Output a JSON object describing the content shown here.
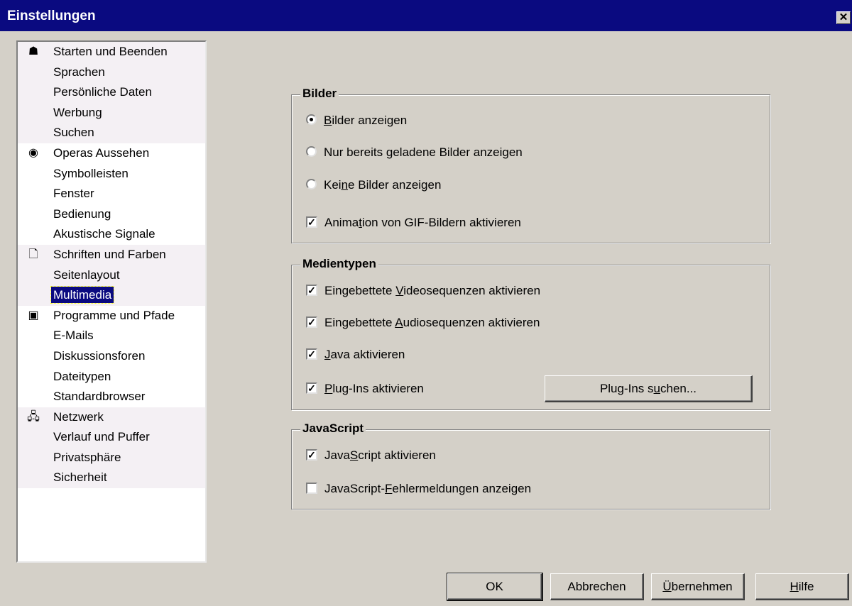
{
  "window": {
    "title": "Einstellungen",
    "close_glyph": "✕"
  },
  "sidebar": {
    "groups": [
      {
        "icon": "person-icon",
        "glyph": "☗",
        "items": [
          {
            "label": "Starten und Beenden"
          },
          {
            "label": "Sprachen"
          },
          {
            "label": "Persönliche Daten"
          },
          {
            "label": "Werbung"
          },
          {
            "label": "Suchen"
          }
        ]
      },
      {
        "icon": "eye-icon",
        "glyph": "◉",
        "items": [
          {
            "label": "Operas Aussehen"
          },
          {
            "label": "Symbolleisten"
          },
          {
            "label": "Fenster"
          },
          {
            "label": "Bedienung"
          },
          {
            "label": "Akustische Signale"
          }
        ]
      },
      {
        "icon": "document-icon",
        "glyph": "🗋",
        "items": [
          {
            "label": "Schriften und Farben"
          },
          {
            "label": "Seitenlayout"
          },
          {
            "label": "Multimedia",
            "selected": true
          }
        ]
      },
      {
        "icon": "floppy-disk-icon",
        "glyph": "▣",
        "items": [
          {
            "label": "Programme und Pfade"
          },
          {
            "label": "E-Mails"
          },
          {
            "label": "Diskussionsforen"
          },
          {
            "label": "Dateitypen"
          },
          {
            "label": "Standardbrowser"
          }
        ]
      },
      {
        "icon": "network-icon",
        "glyph": "🖧",
        "items": [
          {
            "label": "Netzwerk"
          },
          {
            "label": "Verlauf und Puffer"
          },
          {
            "label": "Privatsphäre"
          },
          {
            "label": "Sicherheit"
          }
        ]
      }
    ]
  },
  "bilder": {
    "legend": "Bilder",
    "radio_show": {
      "pre": "",
      "ul": "B",
      "post": "ilder anzeigen",
      "checked": true
    },
    "radio_cached": {
      "pre": "Nur bereits ",
      "ul": "g",
      "post": "eladene Bilder anzeigen",
      "checked": false
    },
    "radio_none": {
      "pre": "Kei",
      "ul": "n",
      "post": "e Bilder anzeigen",
      "checked": false
    },
    "check_gif": {
      "pre": "Anima",
      "ul": "t",
      "post": "ion von GIF-Bildern aktivieren",
      "checked": true
    }
  },
  "medien": {
    "legend": "Medientypen",
    "check_video": {
      "pre": "Eingebettete ",
      "ul": "V",
      "post": "ideosequenzen aktivieren",
      "checked": true
    },
    "check_audio": {
      "pre": "Eingebettete ",
      "ul": "A",
      "post": "udiosequenzen aktivieren",
      "checked": true
    },
    "check_java": {
      "pre": "",
      "ul": "J",
      "post": "ava aktivieren",
      "checked": true
    },
    "check_plugins": {
      "pre": "",
      "ul": "P",
      "post": "lug-Ins aktivieren",
      "checked": true
    },
    "plugins_button": {
      "pre": "Plug-Ins s",
      "ul": "u",
      "post": "chen..."
    }
  },
  "javascript": {
    "legend": "JavaScript",
    "check_enable": {
      "pre": "Java",
      "ul": "S",
      "post": "cript aktivieren",
      "checked": true
    },
    "check_errors": {
      "pre": "JavaScript-",
      "ul": "F",
      "post": "ehlermeldungen anzeigen",
      "checked": false
    }
  },
  "footer": {
    "ok": "OK",
    "cancel": "Abbrechen",
    "apply": {
      "pre": "",
      "ul": "Ü",
      "post": "bernehmen"
    },
    "help": {
      "pre": "",
      "ul": "H",
      "post": "ilfe"
    }
  },
  "check_glyph": "✓"
}
